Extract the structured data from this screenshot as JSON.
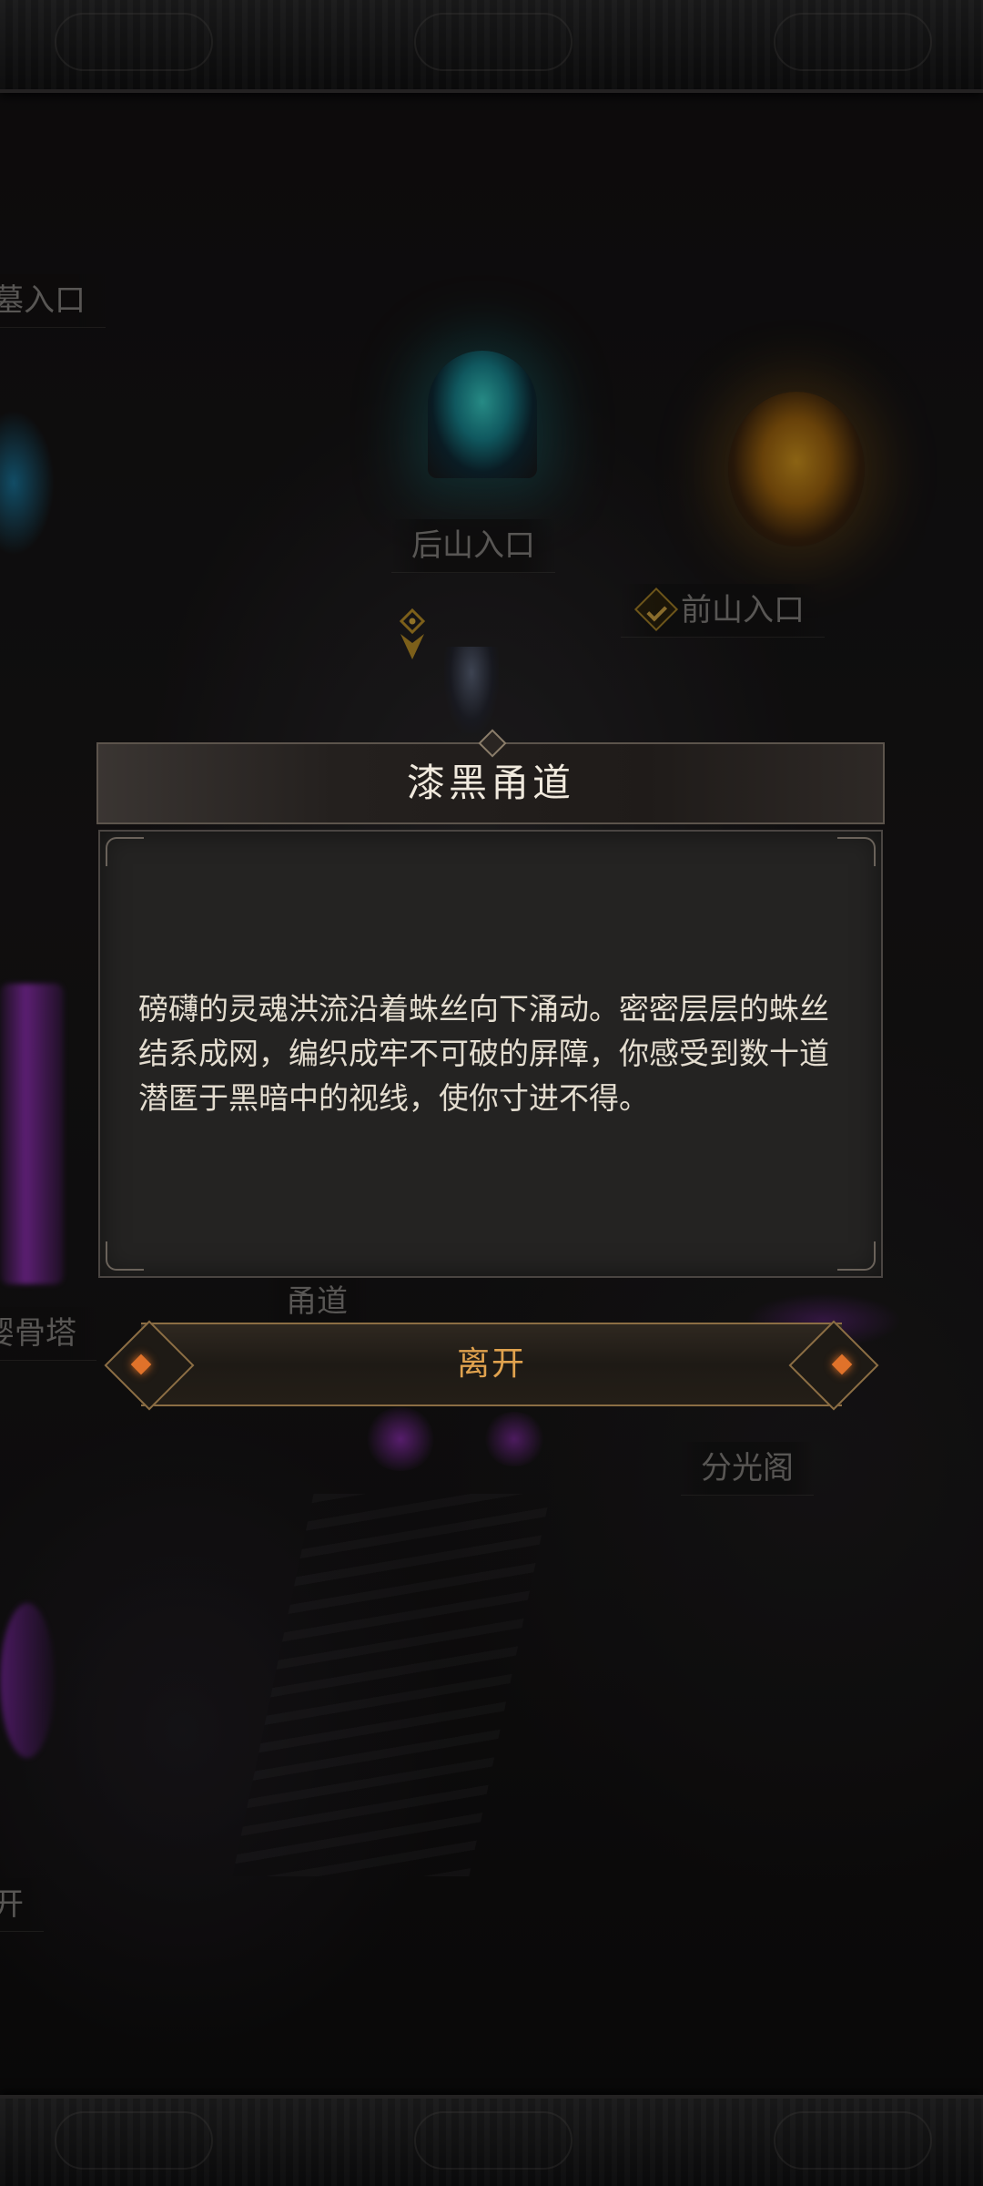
{
  "map": {
    "labels": {
      "top_left": "墓入口",
      "rear_mountain": "后山入口",
      "front_mountain": "前山入口",
      "bone_tower": "婴骨塔",
      "passage": "甬道",
      "fenguang": "分光阁",
      "bottom_left": "开"
    },
    "front_mountain_status_icon": "check-icon"
  },
  "dialog": {
    "title": "漆黑甬道",
    "description": "磅礴的灵魂洪流沿着蛛丝向下涌动。密密层层的蛛丝结系成网，编织成牢不可破的屏障，你感受到数十道潜匿于黑暗中的视线，使你寸进不得。"
  },
  "leave_button": {
    "label": "离开"
  },
  "colors": {
    "accent_gold": "#e0a24e",
    "portal_blue": "#3fe0d7",
    "portal_gold": "#e0a020",
    "glow_purple": "#be3cf0"
  }
}
